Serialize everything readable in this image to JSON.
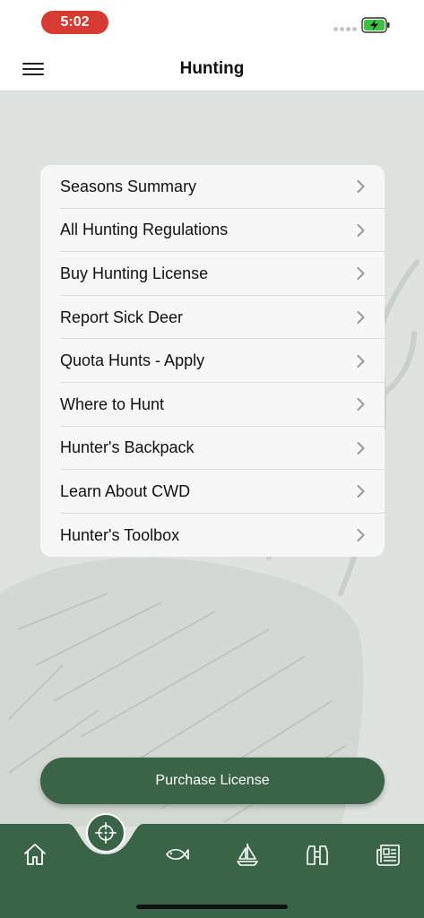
{
  "status_bar": {
    "time": "5:02"
  },
  "header": {
    "title": "Hunting"
  },
  "menu": {
    "items": [
      {
        "label": "Seasons Summary"
      },
      {
        "label": "All Hunting Regulations"
      },
      {
        "label": "Buy Hunting License"
      },
      {
        "label": "Report Sick Deer"
      },
      {
        "label": "Quota Hunts - Apply"
      },
      {
        "label": "Where to Hunt"
      },
      {
        "label": "Hunter's Backpack"
      },
      {
        "label": "Learn About CWD"
      },
      {
        "label": "Hunter's Toolbox"
      }
    ]
  },
  "purchase": {
    "label": "Purchase License"
  },
  "tab_bar": {
    "tabs": [
      {
        "icon": "home-icon"
      },
      {
        "icon": "crosshair-icon",
        "active": true
      },
      {
        "icon": "fish-icon"
      },
      {
        "icon": "sailboat-icon"
      },
      {
        "icon": "binoculars-icon"
      },
      {
        "icon": "newspaper-icon"
      }
    ]
  },
  "colors": {
    "brand_green": "#3a6447",
    "time_pill": "#d63a30",
    "battery_green": "#3cc341"
  }
}
